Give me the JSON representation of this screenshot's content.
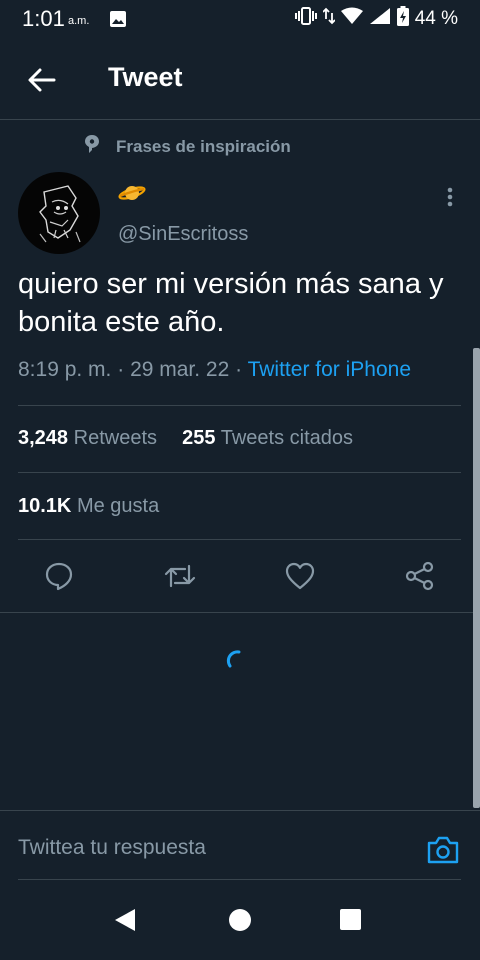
{
  "status_bar": {
    "time": "1:01",
    "ampm": "a.m.",
    "battery_percent": "44 %",
    "icons": [
      "gallery-icon",
      "vibrate-icon",
      "data-arrows-icon",
      "wifi-icon",
      "signal-icon",
      "battery-charging-icon"
    ]
  },
  "header": {
    "title": "Tweet",
    "back_icon": "arrow-left-icon"
  },
  "context": {
    "label": "Frases de inspiración",
    "icon": "topic-pin-icon"
  },
  "tweet": {
    "author_emoji": "🪐",
    "handle": "@SinEscritoss",
    "text": "quiero ser mi versión más sana y bonita este año.",
    "time": "8:19 p. m.",
    "separator": " · ",
    "date": "29 mar. 22",
    "source": "Twitter for iPhone",
    "retweets_count": "3,248",
    "retweets_label": "Retweets",
    "quotes_count": "255",
    "quotes_label": "Tweets citados",
    "likes_count": "10.1K",
    "likes_label": "Me gusta"
  },
  "actions": [
    "reply-icon",
    "retweet-icon",
    "like-icon",
    "share-icon"
  ],
  "reply": {
    "placeholder": "Twittea tu respuesta",
    "camera_icon": "camera-icon"
  },
  "colors": {
    "background": "#15202b",
    "accent": "#1da1f2",
    "secondary_text": "#8899a6",
    "divider": "#38444d"
  }
}
